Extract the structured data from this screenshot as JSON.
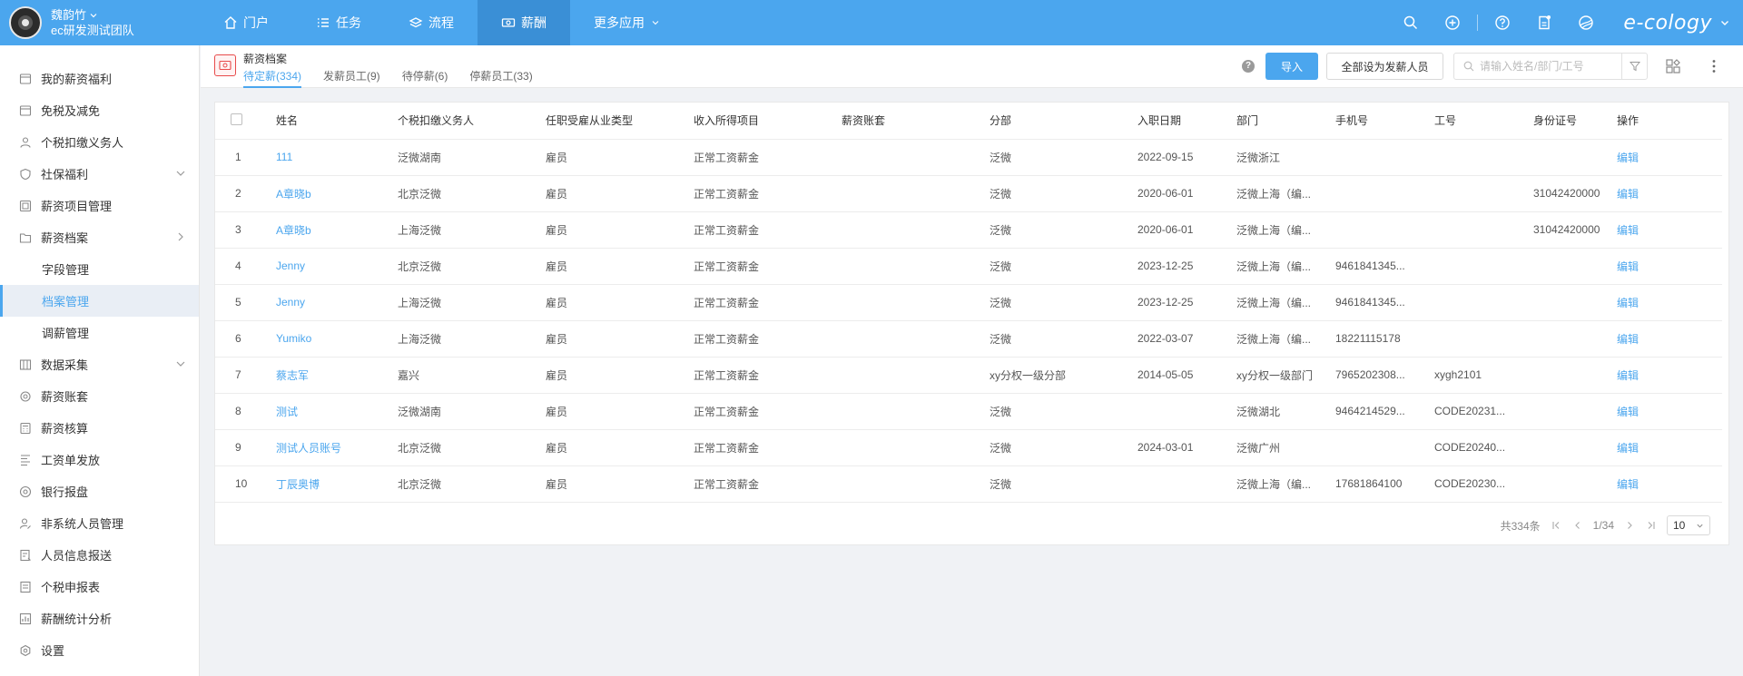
{
  "header": {
    "user_name": "魏韵竹",
    "team": "ec研发测试团队",
    "nav": [
      {
        "label": "门户",
        "icon": "home-icon"
      },
      {
        "label": "任务",
        "icon": "list-icon"
      },
      {
        "label": "流程",
        "icon": "layers-icon"
      },
      {
        "label": "薪酬",
        "icon": "money-icon"
      },
      {
        "label": "更多应用",
        "icon": "chevron-down-icon"
      }
    ],
    "active_nav": "薪酬",
    "logo": "e-cology"
  },
  "sidebar": {
    "items": [
      {
        "label": "我的薪资福利",
        "icon": "wallet-icon"
      },
      {
        "label": "免税及减免",
        "icon": "wallet-icon"
      },
      {
        "label": "个税扣缴义务人",
        "icon": "user-icon"
      },
      {
        "label": "社保福利",
        "icon": "shield-icon"
      },
      {
        "label": "薪资项目管理",
        "icon": "grid-icon"
      },
      {
        "label": "薪资档案",
        "icon": "folder-icon"
      },
      {
        "label": "字段管理",
        "icon": ""
      },
      {
        "label": "档案管理",
        "icon": ""
      },
      {
        "label": "调薪管理",
        "icon": ""
      },
      {
        "label": "数据采集",
        "icon": "data-icon"
      },
      {
        "label": "薪资账套",
        "icon": "settings-icon"
      },
      {
        "label": "薪资核算",
        "icon": "calculator-icon"
      },
      {
        "label": "工资单发放",
        "icon": "doc-icon"
      },
      {
        "label": "银行报盘",
        "icon": "at-icon"
      },
      {
        "label": "非系统人员管理",
        "icon": "user-edit-icon"
      },
      {
        "label": "人员信息报送",
        "icon": "doc-icon"
      },
      {
        "label": "个税申报表",
        "icon": "doc-icon"
      },
      {
        "label": "薪酬统计分析",
        "icon": "chart-icon"
      },
      {
        "label": "设置",
        "icon": "gear-icon"
      }
    ]
  },
  "page": {
    "title": "薪资档案",
    "tabs": [
      "待定薪(334)",
      "发薪员工(9)",
      "待停薪(6)",
      "停薪员工(33)"
    ],
    "help": "?",
    "import_label": "导入",
    "set_all_label": "全部设为发薪人员",
    "search_placeholder": "请输入姓名/部门/工号"
  },
  "table": {
    "columns": [
      "姓名",
      "个税扣缴义务人",
      "任职受雇从业类型",
      "收入所得项目",
      "薪资账套",
      "分部",
      "入职日期",
      "部门",
      "手机号",
      "工号",
      "身份证号",
      "操作"
    ],
    "rows": [
      [
        "1",
        "111",
        "泛微湖南",
        "雇员",
        "正常工资薪金",
        "",
        "泛微",
        "2022-09-15",
        "泛微浙江",
        "",
        "",
        "",
        "编辑"
      ],
      [
        "2",
        "A章晓b",
        "北京泛微",
        "雇员",
        "正常工资薪金",
        "",
        "泛微",
        "2020-06-01",
        "泛微上海（编...",
        "",
        "",
        "31042420000",
        "编辑"
      ],
      [
        "3",
        "A章晓b",
        "上海泛微",
        "雇员",
        "正常工资薪金",
        "",
        "泛微",
        "2020-06-01",
        "泛微上海（编...",
        "",
        "",
        "31042420000",
        "编辑"
      ],
      [
        "4",
        "Jenny",
        "北京泛微",
        "雇员",
        "正常工资薪金",
        "",
        "泛微",
        "2023-12-25",
        "泛微上海（编...",
        "9461841345...",
        "",
        "",
        "编辑"
      ],
      [
        "5",
        "Jenny",
        "上海泛微",
        "雇员",
        "正常工资薪金",
        "",
        "泛微",
        "2023-12-25",
        "泛微上海（编...",
        "9461841345...",
        "",
        "",
        "编辑"
      ],
      [
        "6",
        "Yumiko",
        "上海泛微",
        "雇员",
        "正常工资薪金",
        "",
        "泛微",
        "2022-03-07",
        "泛微上海（编...",
        "18221115178",
        "",
        "",
        "编辑"
      ],
      [
        "7",
        "蔡志军",
        "嘉兴",
        "雇员",
        "正常工资薪金",
        "",
        "xy分权一级分部",
        "2014-05-05",
        "xy分权一级部门",
        "7965202308...",
        "xygh2101",
        "",
        "编辑"
      ],
      [
        "8",
        "测试",
        "泛微湖南",
        "雇员",
        "正常工资薪金",
        "",
        "泛微",
        "",
        "泛微湖北",
        "9464214529...",
        "CODE20231...",
        "",
        "编辑"
      ],
      [
        "9",
        "测试人员账号",
        "北京泛微",
        "雇员",
        "正常工资薪金",
        "",
        "泛微",
        "2024-03-01",
        "泛微广州",
        "",
        "CODE20240...",
        "",
        "编辑"
      ],
      [
        "10",
        "丁辰奥博",
        "北京泛微",
        "雇员",
        "正常工资薪金",
        "",
        "泛微",
        "",
        "泛微上海（编...",
        "17681864100",
        "CODE20230...",
        "",
        "编辑"
      ]
    ]
  },
  "pager": {
    "total": "共334条",
    "page": "1/34",
    "size": "10"
  },
  "colors": {
    "primary": "#4ba6ee",
    "active_nav_bg": "#3a8fd6",
    "link": "#4ba6ee"
  }
}
